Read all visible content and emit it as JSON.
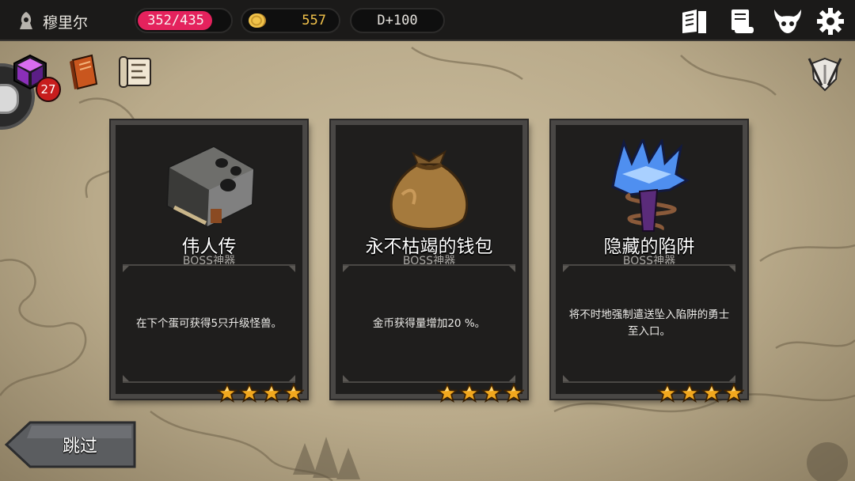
{
  "player": {
    "name": "穆里尔",
    "icon": "hooded-figure-icon"
  },
  "stats": {
    "hp": "352/435",
    "hp_fraction": 0.809,
    "gold": "557",
    "day": "D+100"
  },
  "top_icons": [
    "codex-icon",
    "scroll-icon",
    "demon-skull-icon",
    "gear-icon"
  ],
  "side_icons": [
    "purple-box-icon",
    "spellbook-icon",
    "quest-scroll-icon"
  ],
  "box_badge": "27",
  "right_icon": "shield-swords-icon",
  "cards": [
    {
      "title": "伟人传",
      "subtitle": "BOSS神器",
      "description": "在下个蛋可获得5只升级怪兽。",
      "icon": "stone-book-icon",
      "stars": 4
    },
    {
      "title": "永不枯竭的钱包",
      "subtitle": "BOSS神器",
      "description": "金币获得量增加20 %。",
      "icon": "money-bag-icon",
      "stars": 4
    },
    {
      "title": "隐藏的陷阱",
      "subtitle": "BOSS神器",
      "description": "将不时地强制遣送坠入陷阱的勇士至入口。",
      "icon": "spike-trap-icon",
      "stars": 4
    }
  ],
  "skip_label": "跳过",
  "colors": {
    "hp_bar": "#e4225d",
    "gold_text": "#f2c24a",
    "card_bg": "#1f1e1d",
    "badge": "#c71d1d"
  }
}
